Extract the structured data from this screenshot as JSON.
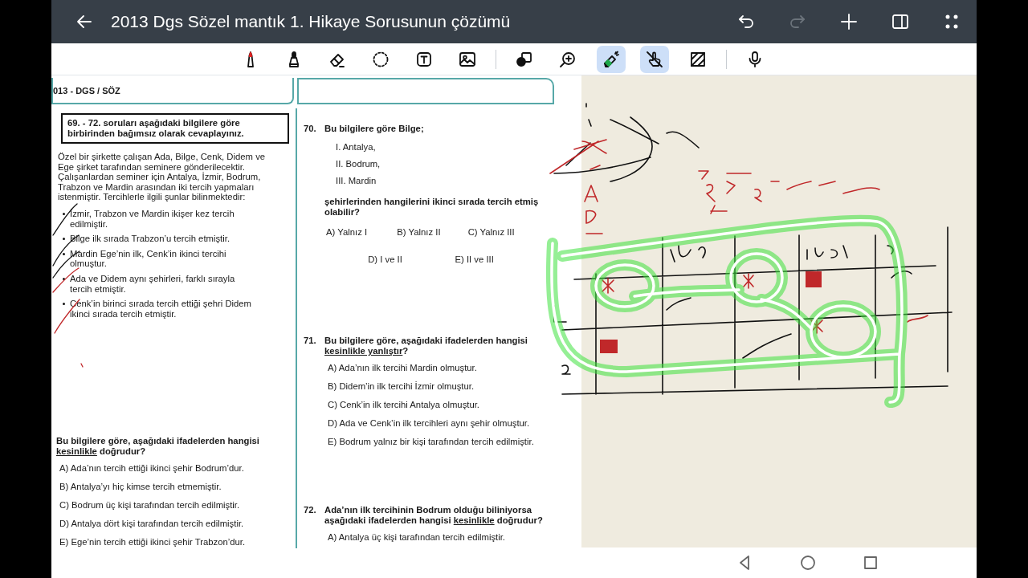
{
  "title_bar": {
    "title": "2013 Dgs Sözel mantık 1. Hikaye Sorusunun çözümü",
    "actions": [
      {
        "kind": "undo",
        "disabled": false
      },
      {
        "kind": "redo",
        "disabled": true
      },
      {
        "kind": "add",
        "disabled": false
      },
      {
        "kind": "panel",
        "disabled": false
      },
      {
        "kind": "more",
        "disabled": false
      }
    ]
  },
  "toolbar": {
    "groups": [
      {
        "tools": [
          {
            "kind": "pen",
            "selected": false
          },
          {
            "kind": "marker",
            "selected": false
          },
          {
            "kind": "eraser",
            "selected": false
          },
          {
            "kind": "lasso",
            "selected": false
          },
          {
            "kind": "text",
            "selected": false
          },
          {
            "kind": "image",
            "selected": false
          }
        ]
      },
      {
        "tools": [
          {
            "kind": "shape",
            "selected": false
          },
          {
            "kind": "zoom",
            "selected": false
          },
          {
            "kind": "highlighter",
            "selected": true
          },
          {
            "kind": "touch",
            "selected": true
          },
          {
            "kind": "pattern",
            "selected": false
          }
        ]
      },
      {
        "tools": [
          {
            "kind": "mic",
            "selected": false
          }
        ]
      }
    ]
  },
  "document": {
    "header": "013 - DGS / SÖZ",
    "instruction": "69. - 72.  soruları aşağıdaki bilgilere göre birbirinden bağımsız olarak cevaplayınız.",
    "intro": "Özel bir şirkette çalışan Ada, Bilge, Cenk, Didem ve Ege şirket tarafından seminere gönderilecektir. Çalışanlardan seminer için Antalya, İzmir, Bodrum, Trabzon ve Mardin arasından iki tercih yapmaları istenmiştir. Tercihlerle ilgili şunlar bilinmektedir:",
    "facts": [
      "İzmir, Trabzon ve Mardin ikişer kez tercih edilmiştir.",
      "Bilge ilk sırada Trabzon’u tercih etmiştir.",
      "Mardin Ege’nin ilk, Cenk’in ikinci tercihi olmuştur.",
      "Ada ve Didem aynı şehirleri, farklı sırayla tercih etmiştir.",
      "Cenk’in birinci sırada tercih ettiği şehri Didem ikinci sırada tercih etmiştir."
    ],
    "left_question": {
      "stem": [
        {
          "text": "Bu bilgilere göre, aşağıdaki ifadelerden hangisi ",
          "underline": false
        },
        {
          "text": "kesinlikle",
          "underline": true
        },
        {
          "text": " doğrudur?",
          "underline": false
        }
      ],
      "options": [
        {
          "letter": "A)",
          "text": "Ada’nın tercih ettiği ikinci şehir Bodrum’dur."
        },
        {
          "letter": "B)",
          "text": "Antalya’yı hiç kimse tercih etmemiştir."
        },
        {
          "letter": "C)",
          "text": "Bodrum üç kişi tarafından tercih edilmiştir."
        },
        {
          "letter": "D)",
          "text": "Antalya dört kişi tarafından tercih edilmiştir."
        },
        {
          "letter": "E)",
          "text": "Ege’nin tercih ettiği ikinci şehir Trabzon’dur."
        }
      ]
    },
    "questions": [
      {
        "number": "70.",
        "kind": "grid",
        "stem": [
          {
            "text": "Bu bilgilere göre Bilge;",
            "underline": false
          }
        ],
        "items": [
          {
            "numeral": "I.",
            "text": "Antalya,"
          },
          {
            "numeral": "II.",
            "text": "Bodrum,"
          },
          {
            "numeral": "III.",
            "text": "Mardin"
          }
        ],
        "continuation": "şehirlerinden hangilerini ikinci sırada tercih etmiş olabilir?",
        "options": [
          {
            "letter": "A)",
            "text": "Yalnız I"
          },
          {
            "letter": "B)",
            "text": "Yalnız II"
          },
          {
            "letter": "C)",
            "text": "Yalnız III"
          },
          {
            "letter": "D)",
            "text": "I ve II"
          },
          {
            "letter": "E)",
            "text": "II ve III"
          }
        ]
      },
      {
        "number": "71.",
        "kind": "list",
        "stem": [
          {
            "text": "Bu bilgilere göre, aşağıdaki ifadelerden hangisi ",
            "underline": false
          },
          {
            "text": "kesinlikle yanlıştır",
            "underline": true
          },
          {
            "text": "?",
            "underline": false
          }
        ],
        "options": [
          {
            "letter": "A)",
            "text": "Ada’nın ilk tercihi Mardin olmuştur."
          },
          {
            "letter": "B)",
            "text": "Didem’in ilk tercihi İzmir olmuştur."
          },
          {
            "letter": "C)",
            "text": "Cenk’in ilk tercihi Antalya olmuştur."
          },
          {
            "letter": "D)",
            "text": "Ada ve Cenk’in ilk tercihleri aynı şehir olmuştur."
          },
          {
            "letter": "E)",
            "text": "Bodrum yalnız bir kişi tarafından tercih edilmiştir."
          }
        ]
      },
      {
        "number": "72.",
        "kind": "list",
        "stem": [
          {
            "text": "Ada’nın ilk tercihinin Bodrum olduğu biliniyorsa aşağıdaki ifadelerden hangisi ",
            "underline": false
          },
          {
            "text": "kesinlikle",
            "underline": true
          },
          {
            "text": " doğrudur?",
            "underline": false
          }
        ],
        "options": [
          {
            "letter": "A)",
            "text": "Antalya üç kişi tarafından tercih edilmiştir."
          }
        ]
      }
    ]
  },
  "nav_bar": {
    "buttons": [
      {
        "kind": "back"
      },
      {
        "kind": "home"
      },
      {
        "kind": "recents"
      }
    ]
  }
}
